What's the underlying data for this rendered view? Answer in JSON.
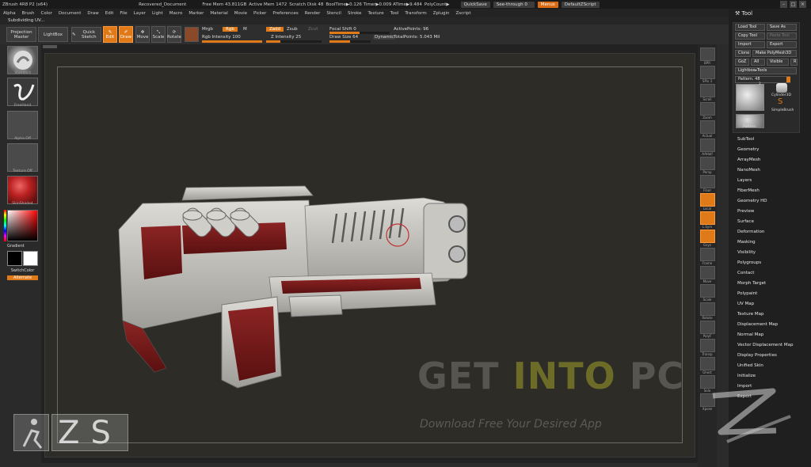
{
  "titlebar": {
    "app": "ZBrush 4R8 P2 (x64)",
    "document": "Recovered_Document",
    "free_mem": "Free Mem 43.811GB",
    "active_mem": "Active Mem 1472",
    "scratch": "Scratch Disk 48",
    "bool": "BoolTime▶0.126 Timer▶0.009 ATime▶9.484",
    "polycount": "PolyCount▶",
    "quicksave": "QuickSave",
    "seethrough": "See-through  0",
    "menus": "Menus",
    "script": "DefaultZScript"
  },
  "menubar": [
    "Alpha",
    "Brush",
    "Color",
    "Document",
    "Draw",
    "Edit",
    "File",
    "Layer",
    "Light",
    "Macro",
    "Marker",
    "Material",
    "Movie",
    "Picker",
    "Preferences",
    "Render",
    "Stencil",
    "Stroke",
    "Texture",
    "Tool",
    "Transform",
    "Zplugin",
    "Zscript"
  ],
  "status": "Subdividing UV...",
  "shelf": {
    "projection_master": "Projection Master",
    "lightbox": "LightBox",
    "quick_sketch": "Quick Sketch",
    "edit": "Edit",
    "draw": "Draw",
    "move": "Move",
    "scale": "Scale",
    "rotate": "Rotate",
    "mrgb": "Mrgb",
    "rgb": "Rgb",
    "m": "M",
    "rgb_intensity": "Rgb Intensity 100",
    "zadd": "Zadd",
    "zsub": "Zsub",
    "zcut": "Zcut",
    "z_intensity": "Z Intensity 25",
    "focal_shift": "Focal Shift 0",
    "draw_size": "Draw Size 64",
    "dynamic": "Dynamic",
    "active_points": "ActivePoints: 96",
    "total_points": "TotalPoints: 5.043 Mil",
    "rgb_intensity_value": 100,
    "z_intensity_value": 25,
    "draw_size_value": 64
  },
  "lefttray": {
    "standard": "Standard",
    "freehand": "FreeHand",
    "alpha_off": "Alpha Off",
    "texture_off": "Texture Off",
    "material": "SkinShade4",
    "gradient": "Gradient",
    "switchcolor": "SwitchColor",
    "alternate": "Alternate"
  },
  "rightshelf": [
    "BPR",
    "SPix 3",
    "Scroll",
    "Zoom",
    "Actual",
    "AAHalf",
    "Persp",
    "Floor",
    "Local",
    "L.Sym",
    "Gxyz",
    "Frame",
    "Move",
    "Scale",
    "Rotate",
    "PolyF",
    "Transp",
    "Ghost",
    "Solo",
    "Xpose"
  ],
  "tool": {
    "title": "Tool",
    "load_tool": "Load Tool",
    "save_as": "Save As",
    "copy_tool": "Copy Tool",
    "paste_tool": "Paste Tool",
    "import": "Import",
    "export": "Export",
    "clone": "Clone",
    "make_polymesh": "Make PolyMesh3D",
    "goz": "GoZ",
    "all": "All",
    "visible": "Visible",
    "r": "R",
    "lightbox_tools": "Lightbox▸Tools",
    "pattern": "Pattern. 48",
    "thumb_count": "2",
    "cylinder": "Cylinder3D",
    "simplebrush": "SimpleBrush",
    "pattern_thumb": "Pattern",
    "menu_items": [
      "SubTool",
      "Geometry",
      "ArrayMesh",
      "NanoMesh",
      "Layers",
      "FiberMesh",
      "Geometry HD",
      "Preview",
      "Surface",
      "Deformation",
      "Masking",
      "Visibility",
      "Polygroups",
      "Contact",
      "Morph Target",
      "Polypaint",
      "UV Map",
      "Texture Map",
      "Displacement Map",
      "Normal Map",
      "Vector Displacement Map",
      "Display Properties",
      "Unified Skin",
      "Initialize",
      "Import",
      "Export"
    ]
  },
  "watermark": {
    "get": "GET ",
    "into": "INTO",
    "pc": " PC",
    "sub": "Download Free Your Desired App",
    "zs": "ZS"
  },
  "colors": {
    "accent": "#e07a18",
    "panel": "#1f1f1f",
    "canvas": "#2d2c27",
    "model_body": "#c9c8c3",
    "model_red": "#7a1a1a"
  }
}
